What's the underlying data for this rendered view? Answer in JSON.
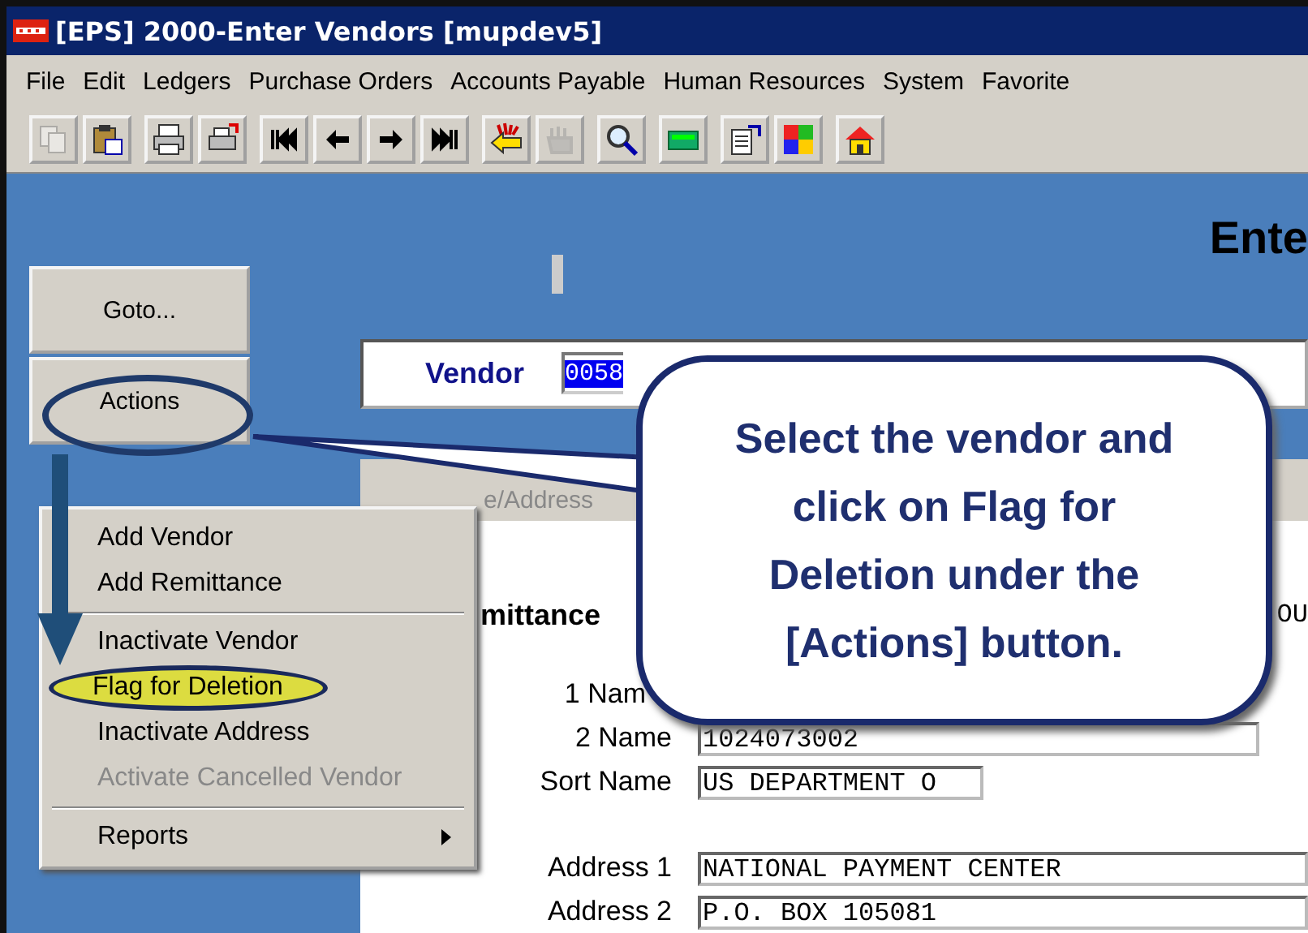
{
  "window": {
    "title": "[EPS] 2000-Enter Vendors [mupdev5]"
  },
  "menu": [
    "File",
    "Edit",
    "Ledgers",
    "Purchase Orders",
    "Accounts Payable",
    "Human Resources",
    "System",
    "Favorite"
  ],
  "toolbar": [
    [
      {
        "kind": "copy",
        "disabled": true
      },
      {
        "kind": "paste",
        "disabled": false
      }
    ],
    [
      {
        "kind": "print",
        "disabled": false
      },
      {
        "kind": "print-send",
        "disabled": false
      }
    ],
    [
      {
        "kind": "first",
        "disabled": false
      },
      {
        "kind": "prev",
        "disabled": false
      },
      {
        "kind": "next",
        "disabled": false
      },
      {
        "kind": "last",
        "disabled": false
      }
    ],
    [
      {
        "kind": "exit",
        "disabled": false
      },
      {
        "kind": "hand",
        "disabled": true
      }
    ],
    [
      {
        "kind": "search",
        "disabled": false
      }
    ],
    [
      {
        "kind": "calculator",
        "disabled": false
      }
    ],
    [
      {
        "kind": "properties",
        "disabled": false
      },
      {
        "kind": "windows",
        "disabled": false
      }
    ],
    [
      {
        "kind": "home",
        "disabled": false
      }
    ]
  ],
  "heading": "Ente",
  "side_buttons": [
    "Goto...",
    "Actions"
  ],
  "vendor": {
    "label": "Vendor",
    "value": "0058"
  },
  "tab": {
    "label": "e/Address"
  },
  "section": {
    "title": "mittance",
    "right_text": "OU"
  },
  "fields": [
    {
      "label": "1 Nam"
    },
    {
      "label": "2 Name",
      "value": "1024073002"
    },
    {
      "label": "Sort Name",
      "value": "US DEPARTMENT O"
    },
    {
      "label": "Address 1",
      "value": "NATIONAL PAYMENT CENTER"
    },
    {
      "label": "Address 2",
      "value": "P.O. BOX 105081"
    }
  ],
  "popup_menu": [
    {
      "kind": "item",
      "label": "Add Vendor",
      "selected": false,
      "disabled": false
    },
    {
      "kind": "item",
      "label": "Add Remittance",
      "selected": false,
      "disabled": false
    },
    {
      "kind": "separator"
    },
    {
      "kind": "item",
      "label": "Inactivate Vendor",
      "selected": false,
      "disabled": false
    },
    {
      "kind": "item",
      "label": "Flag for Deletion",
      "selected": true,
      "disabled": false
    },
    {
      "kind": "item",
      "label": "Inactivate Address",
      "selected": false,
      "disabled": false
    },
    {
      "kind": "item",
      "label": "Activate Cancelled Vendor",
      "selected": false,
      "disabled": true
    },
    {
      "kind": "separator"
    },
    {
      "kind": "submenu",
      "label": "Reports",
      "selected": false,
      "disabled": false
    }
  ],
  "callout": {
    "text": "Select the vendor and click on Flag for Deletion under the [Actions] button."
  }
}
